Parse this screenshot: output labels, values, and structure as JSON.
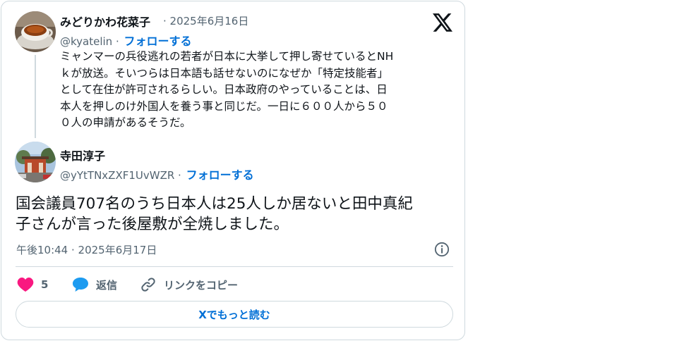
{
  "quoted_post": {
    "author_name": "みどりかわ花菜子",
    "date": "· 2025年6月16日",
    "handle": "@kyatelin ·",
    "follow_label": "フォローする",
    "text_lines": [
      "ミャンマーの兵役逃れの若者が日本に大挙して押し寄せているとNH",
      "ｋが放送。そいつらは日本語も話せないのになぜか「特定技能者」",
      "として在住が許可されるらしい。日本政府のやっていることは、日",
      "本人を押しのけ外国人を養う事と同じだ。一日に６００人から５０",
      "０人の申請があるそうだ。"
    ]
  },
  "reply_post": {
    "author_name": "寺田淳子",
    "handle": "@yYtTNxZXF1UvWZR ·",
    "follow_label": "フォローする",
    "text_lines": [
      "国会議員707名のうち日本人は25人しか居ないと田中真紀",
      "子さんが言った後屋敷が全焼しました。"
    ],
    "timestamp": "午後10:44 · 2025年6月17日"
  },
  "actions": {
    "like_count": "5",
    "reply_label": "返信",
    "copy_link_label": "リンクをコピー"
  },
  "read_more_label": "Xでもっと読む",
  "icons": {
    "brand": "x-logo-icon",
    "info": "info-icon",
    "like": "heart-icon",
    "reply": "speech-bubble-icon",
    "link": "link-icon"
  },
  "colors": {
    "link_blue": "#006fd6",
    "like_pink": "#f91880",
    "reply_blue": "#1d9bf0",
    "muted_gray": "#536471",
    "border": "#cfd9de"
  }
}
